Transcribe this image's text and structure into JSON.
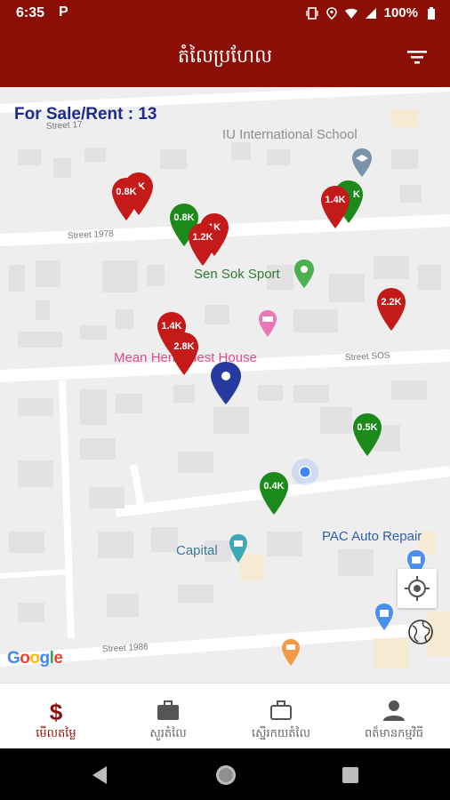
{
  "status_bar": {
    "time": "6:35",
    "app_badge": "P",
    "battery": "100%"
  },
  "app_bar": {
    "title": "តំលៃប្រហែល"
  },
  "listing_count": "For Sale/Rent : 13",
  "map": {
    "places": {
      "school": "IU International School",
      "sport": "Sen Sok Sport",
      "guest_house": "Mean Hen Guest House",
      "capital": "Capital",
      "pac": "PAC Auto Repair"
    },
    "streets": {
      "street17": "Street 17",
      "street1978": "Street 1978",
      "street_sos": "Street SOS",
      "street1986": "Street 1986"
    },
    "pins": [
      {
        "label": "0.8K",
        "color": "red"
      },
      {
        "label": "1K",
        "color": "red"
      },
      {
        "label": "0.8K",
        "color": "green"
      },
      {
        "label": "1K",
        "color": "red"
      },
      {
        "label": "1.2K",
        "color": "red"
      },
      {
        "label": "K",
        "color": "green"
      },
      {
        "label": "1.4K",
        "color": "red"
      },
      {
        "label": "2.2K",
        "color": "red"
      },
      {
        "label": "1.4K",
        "color": "red"
      },
      {
        "label": "2.8K",
        "color": "red"
      },
      {
        "label": "0.5K",
        "color": "green"
      },
      {
        "label": "0.4K",
        "color": "green"
      }
    ],
    "attribution": "Google"
  },
  "colors": {
    "red_pin": "#c41a1a",
    "green_pin": "#1b8a1b",
    "blue_pin": "#263aa0",
    "brand": "#8b0f07"
  },
  "bottom_nav": [
    {
      "label": "មើលតម្លៃ",
      "icon": "dollar-icon"
    },
    {
      "label": "សួរតំលៃ",
      "icon": "briefcase-filled-icon"
    },
    {
      "label": "ស្នើរកយតំលៃ",
      "icon": "briefcase-outline-icon"
    },
    {
      "label": "ពត៏មានកម្មវិធី",
      "icon": "person-icon"
    }
  ]
}
